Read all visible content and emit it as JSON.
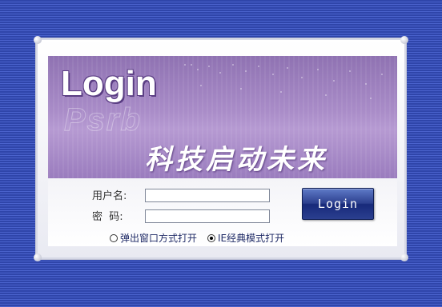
{
  "banner": {
    "title": "Login",
    "slogan": "科技启动未来"
  },
  "form": {
    "username_label": "用户名:",
    "password_label": "密  码:",
    "username_value": "",
    "password_value": "",
    "login_button": "Login"
  },
  "open_mode": {
    "options": [
      {
        "label": "弹出窗口方式打开",
        "selected": false
      },
      {
        "label": "IE经典模式打开",
        "selected": true
      }
    ]
  },
  "colors": {
    "background": "#3a4fb8",
    "banner": "#a98cc8",
    "button": "#2c3f8e"
  }
}
